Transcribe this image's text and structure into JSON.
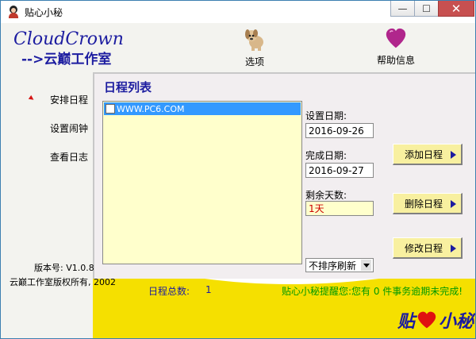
{
  "window": {
    "title": "贴心小秘",
    "minimize_glyph": "—",
    "maximize_glyph": "☐",
    "close_glyph": "✕"
  },
  "header": {
    "logo_main": "CloudCrown",
    "logo_sub": "-->云巅工作室",
    "options_label": "选项",
    "help_label": "帮助信息",
    "options_icon": "dog-icon",
    "help_icon": "heart-icon"
  },
  "nav": {
    "items": [
      {
        "label": "安排日程",
        "selected": true
      },
      {
        "label": "设置闹钟",
        "selected": false
      },
      {
        "label": "查看日志",
        "selected": false
      }
    ]
  },
  "panel": {
    "title": "日程列表",
    "list": [
      {
        "text": "WWW.PC6.COM",
        "checked": false,
        "selected": true
      }
    ],
    "set_date_label": "设置日期:",
    "set_date_value": "2016-09-26",
    "finish_date_label": "完成日期:",
    "finish_date_value": "2016-09-27",
    "remaining_label": "剩余天数:",
    "remaining_value": "1天",
    "sort_select": "不排序刷新"
  },
  "buttons": {
    "add": "添加日程",
    "delete": "删除日程",
    "edit": "修改日程"
  },
  "status": {
    "count_label": "日程总数:",
    "count_value": "1",
    "reminder": "贴心小秘提醒您:您有 0 件事务逾期未完成!"
  },
  "footer": {
    "version": "版本号: V1.0.8",
    "copyright": "云巅工作室版权所有, 2002",
    "signature_left": "贴",
    "signature_right": "小秘"
  },
  "colors": {
    "brand_blue": "#1c1ca0",
    "accent_yellow": "#f5e000",
    "list_bg": "#ffffcc",
    "selection": "#3399ff",
    "reminder_green": "#009900",
    "remaining_red": "#cc0000"
  }
}
